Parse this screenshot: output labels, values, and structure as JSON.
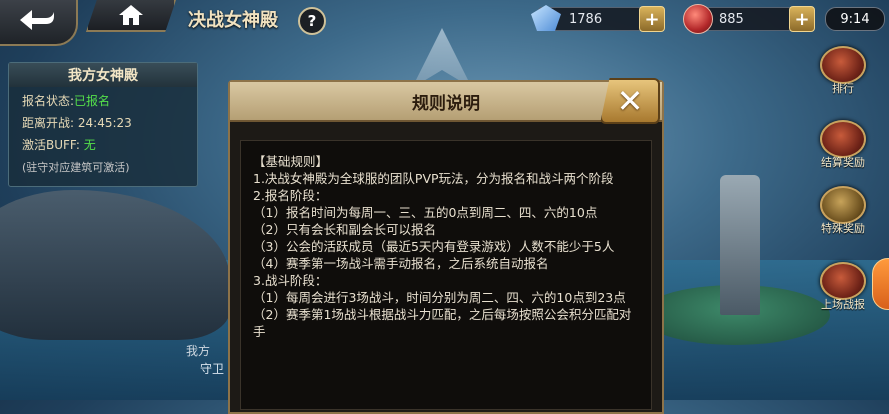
{
  "topbar": {
    "title": "决战女神殿",
    "help": "?",
    "crystal": "1786",
    "ruby": "885",
    "time": "9:14",
    "plus": "+"
  },
  "info_panel": {
    "title": "我方女神殿",
    "status_label": "报名状态:",
    "status_value": "已报名",
    "countdown_label": "距离开战:",
    "countdown_value": "24:45:23",
    "buff_label": "激活BUFF:",
    "buff_value": "无",
    "note": "(驻守对应建筑可激活)"
  },
  "side_buttons": [
    {
      "label": "排行"
    },
    {
      "label": "结算奖励"
    },
    {
      "label": "特殊奖励"
    },
    {
      "label": "上场战报"
    }
  ],
  "bottom": {
    "text1": "我方",
    "text2": "守卫"
  },
  "dialog": {
    "title": "规则说明",
    "close": "✕",
    "lines": [
      "【基础规则】",
      "1.决战女神殿为全球服的团队PVP玩法，分为报名和战斗两个阶段",
      "2.报名阶段：",
      "（1）报名时间为每周一、三、五的0点到周二、四、六的10点",
      "（2）只有会长和副会长可以报名",
      "（3）公会的活跃成员（最近5天内有登录游戏）人数不能少于5人",
      "（4）赛季第一场战斗需手动报名，之后系统自动报名",
      "3.战斗阶段：",
      "（1）每周会进行3场战斗，时间分别为周二、四、六的10点到23点",
      "（2）赛季第1场战斗根据战斗力匹配，之后每场按照公会积分匹配对手"
    ]
  }
}
